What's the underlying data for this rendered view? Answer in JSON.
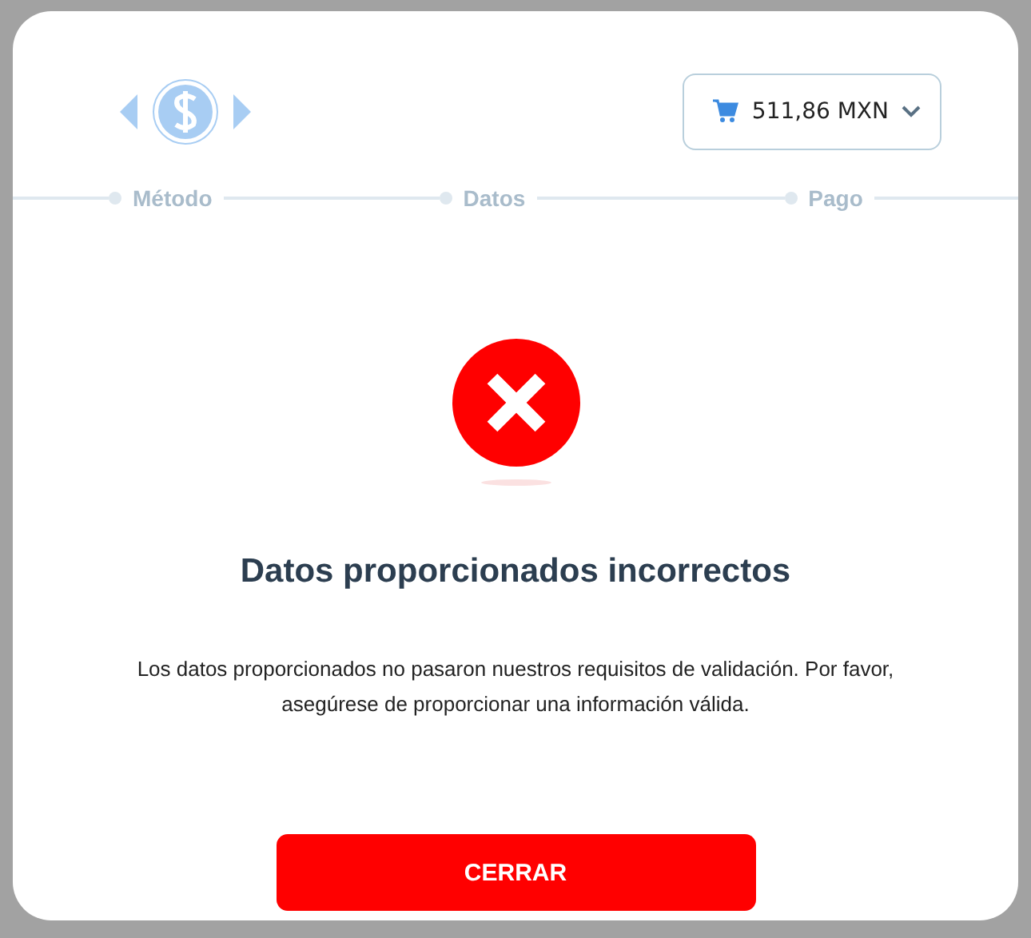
{
  "cart": {
    "amount": "511,86 MXN"
  },
  "steps": [
    {
      "label": "Método"
    },
    {
      "label": "Datos"
    },
    {
      "label": "Pago"
    }
  ],
  "result": {
    "title": "Datos proporcionados incorrectos",
    "message": "Los datos proporcionados no pasaron nuestros requisitos de validación. Por favor, asegúrese de proporcionar una información válida."
  },
  "button": {
    "label": "CERRAR"
  }
}
